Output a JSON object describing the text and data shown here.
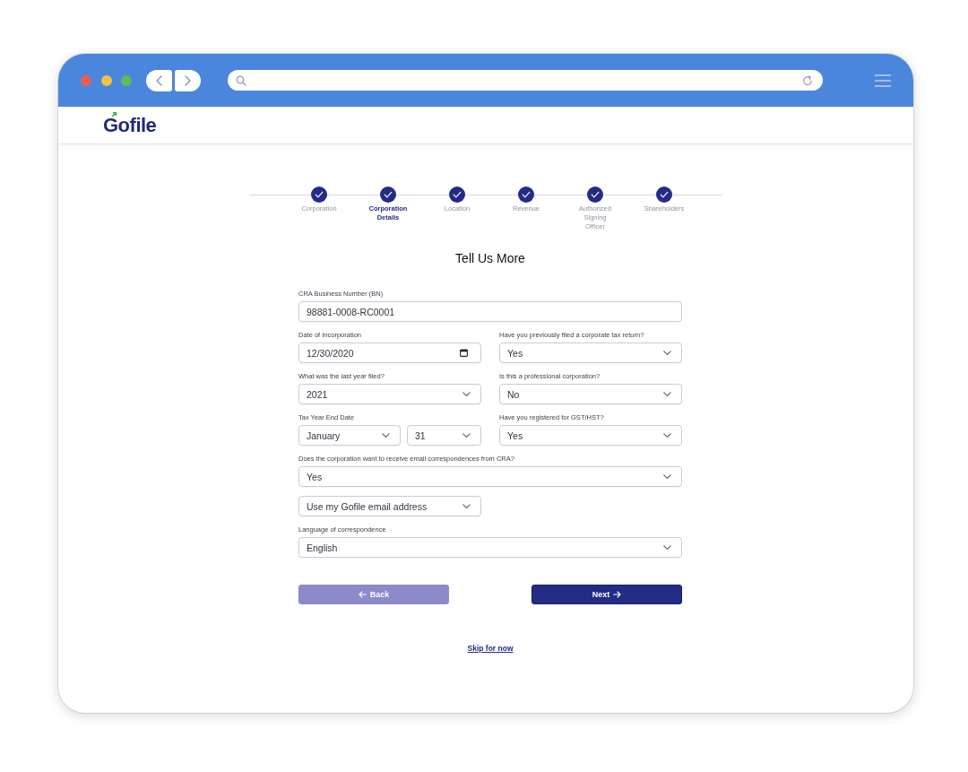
{
  "header": {
    "logo": "Gofile"
  },
  "stepper": {
    "steps": [
      {
        "label": "Corporation",
        "completed": true,
        "selected": false
      },
      {
        "label": "Corporation Details",
        "completed": true,
        "selected": true
      },
      {
        "label": "Location",
        "completed": true,
        "selected": false
      },
      {
        "label": "Revenue",
        "completed": true,
        "selected": false
      },
      {
        "label": "Authorized Signing Officer",
        "completed": true,
        "selected": false
      },
      {
        "label": "Shareholders",
        "completed": true,
        "selected": false
      }
    ]
  },
  "form": {
    "title": "Tell Us More",
    "rows": [
      {
        "groups": [
          {
            "label": "CRA Business Number (BN)",
            "inputs": [
              {
                "kind": "text",
                "value": "98881-0008-RC0001"
              }
            ]
          }
        ]
      },
      {
        "groups": [
          {
            "label": "Date of Incorporation",
            "inputs": [
              {
                "kind": "date",
                "value": "12/30/2020"
              }
            ]
          },
          {
            "label": "Have you previously filed a corporate tax return?",
            "inputs": [
              {
                "kind": "select",
                "value": "Yes"
              }
            ]
          }
        ]
      },
      {
        "groups": [
          {
            "label": "What was the last year filed?",
            "inputs": [
              {
                "kind": "select",
                "value": "2021"
              }
            ]
          },
          {
            "label": "Is this a professional corporation?",
            "inputs": [
              {
                "kind": "select",
                "value": "No"
              }
            ]
          }
        ]
      },
      {
        "groups": [
          {
            "label": "Tax Year End Date",
            "inputs": [
              {
                "kind": "select",
                "value": "January"
              },
              {
                "kind": "select",
                "value": "31"
              }
            ]
          },
          {
            "label": "Have you registered for GST/HST?",
            "inputs": [
              {
                "kind": "select",
                "value": "Yes"
              }
            ]
          }
        ]
      },
      {
        "groups": [
          {
            "label": "Does the corporation want to receive email correspondences from CRA?",
            "inputs": [
              {
                "kind": "select",
                "value": "Yes"
              }
            ],
            "follow_up": {
              "kind": "select",
              "value": "Use my Gofile email address"
            }
          }
        ]
      },
      {
        "groups": [
          {
            "label": "Language of correspondence",
            "inputs": [
              {
                "kind": "select",
                "value": "English"
              }
            ]
          }
        ]
      }
    ],
    "buttons": [
      {
        "kind": "back",
        "label": "Back"
      },
      {
        "kind": "next",
        "label": "Next"
      }
    ],
    "skip_link": "Skip for now"
  }
}
